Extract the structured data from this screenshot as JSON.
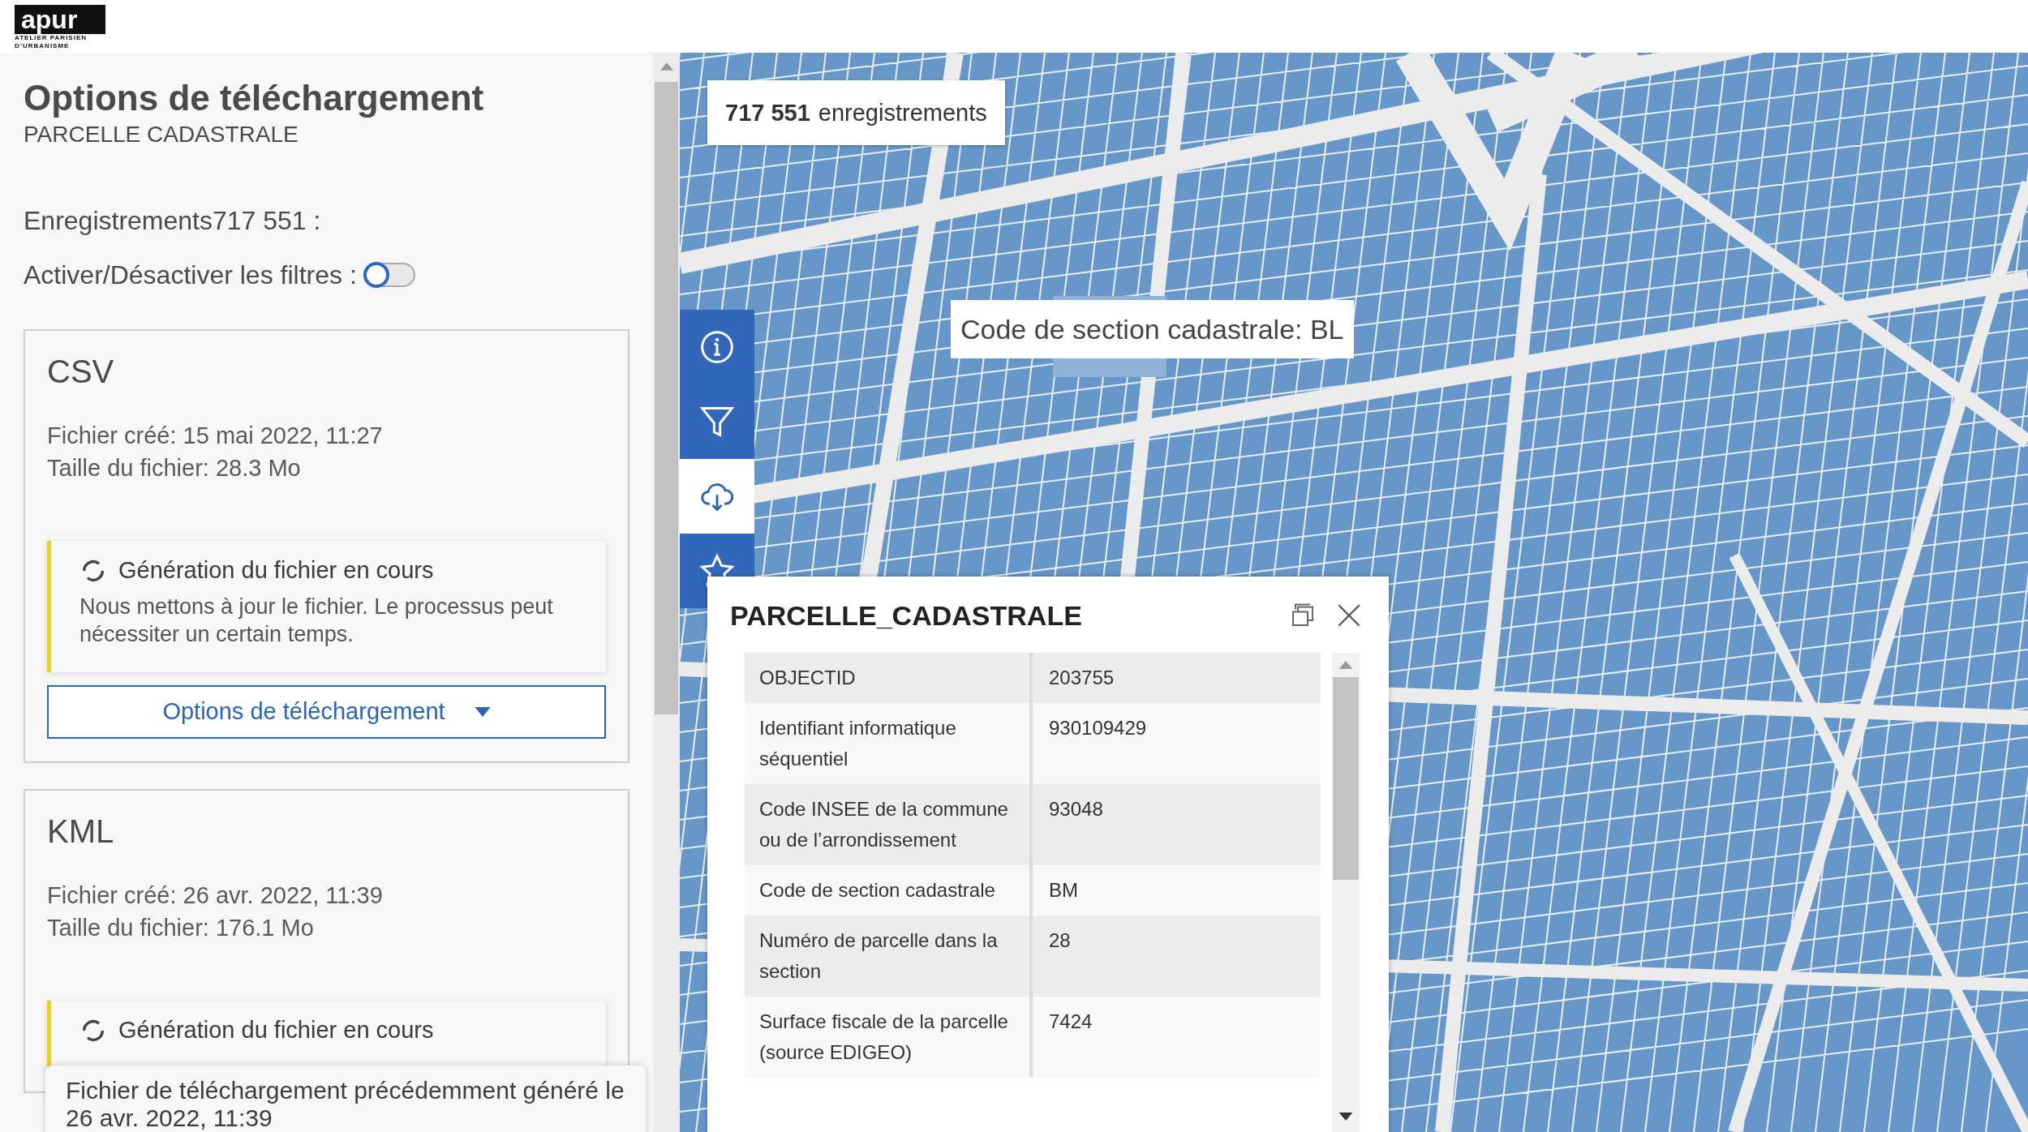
{
  "logo": {
    "mark": "apur",
    "lines": [
      "ATELIER PARISIEN",
      "D’URBANISME"
    ]
  },
  "panel": {
    "title": "Options de téléchargement",
    "subtitle": "PARCELLE CADASTRALE",
    "records": "Enregistrements717 551 :",
    "filters": {
      "label": "Activer/Désactiver les filtres :",
      "on": false
    }
  },
  "files": [
    {
      "format": "CSV",
      "created": "Fichier créé: 15 mai 2022, 11:27",
      "size": "Taille du fichier: 28.3 Mo",
      "notice": {
        "title": "Génération du fichier en cours",
        "text": "Nous mettons à jour le fichier. Le processus peut nécessiter un certain temps."
      },
      "button": "Options de téléchargement"
    },
    {
      "format": "KML",
      "created": "Fichier créé: 26 avr. 2022, 11:39",
      "size": "Taille du fichier: 176.1 Mo",
      "notice": {
        "title": "Génération du fichier en cours"
      }
    }
  ],
  "toast": "Fichier de téléchargement précédemment généré le 26 avr. 2022, 11:39",
  "map": {
    "count": {
      "number": "717 551",
      "label": "enregistrements"
    },
    "tooltip": "Code de section cadastrale: BL",
    "tools": [
      {
        "kind": "info",
        "selected": false
      },
      {
        "kind": "filter",
        "selected": false
      },
      {
        "kind": "download",
        "selected": true
      },
      {
        "kind": "favorites",
        "selected": false
      }
    ],
    "popup": {
      "title": "PARCELLE_CADASTRALE",
      "rows": [
        {
          "field": "OBJECTID",
          "value": "203755"
        },
        {
          "field": "Identifiant informatique séquentiel",
          "value": "930109429"
        },
        {
          "field": "Code INSEE de la commune ou de l’arrondissement",
          "value": "93048"
        },
        {
          "field": "Code de section cadastrale",
          "value": "BM"
        },
        {
          "field": "Numéro de parcelle dans la section",
          "value": "28"
        },
        {
          "field": "Surface fiscale de la parcelle (source EDIGEO)",
          "value": "7424"
        }
      ]
    }
  }
}
